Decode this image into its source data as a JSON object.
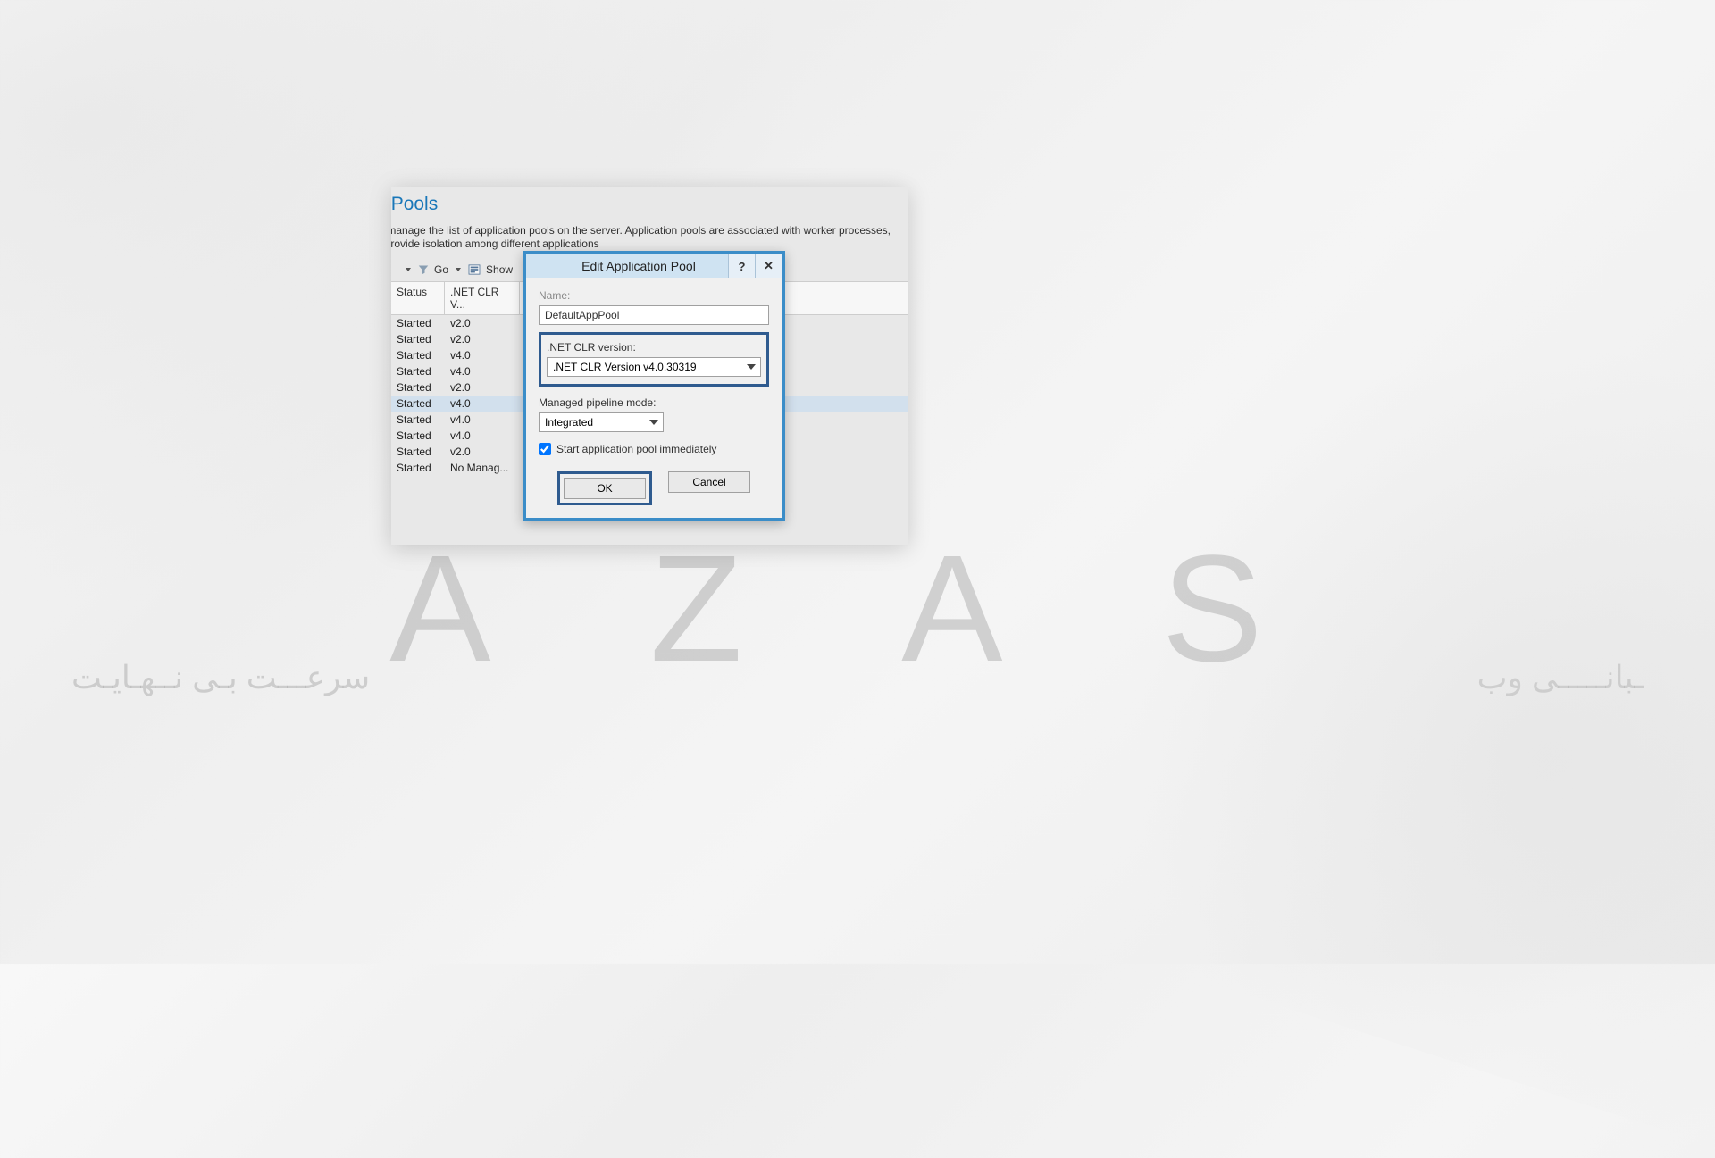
{
  "background": {
    "watermark_letters": "A  Z  A      S",
    "watermark_sub_left": "سرعـــت بـی نــهـایـت",
    "watermark_sub_right": "ـبانـــــی وب"
  },
  "page": {
    "title_truncated": "tion Pools",
    "description_truncated": "w and manage the list of application pools on the server. Application pools are associated with worker processes, con\nd provide isolation among different applications"
  },
  "toolbar": {
    "go_label": "Go",
    "show_label": "Show"
  },
  "columns": {
    "status": "Status",
    "clr": ".NET CLR V..."
  },
  "rows": [
    {
      "status": "Started",
      "clr": "v2.0"
    },
    {
      "status": "Started",
      "clr": "v2.0"
    },
    {
      "status": "Started",
      "clr": "v4.0"
    },
    {
      "status": "Started",
      "clr": "v4.0"
    },
    {
      "status": "Started",
      "clr": "v2.0"
    },
    {
      "status": "Started",
      "clr": "v4.0",
      "highlight": true
    },
    {
      "status": "Started",
      "clr": "v4.0"
    },
    {
      "status": "Started",
      "clr": "v4.0"
    },
    {
      "status": "Started",
      "clr": "v2.0"
    },
    {
      "status": "Started",
      "clr": "No Manag..."
    }
  ],
  "dialog": {
    "title": "Edit Application Pool",
    "help_symbol": "?",
    "close_symbol": "✕",
    "name_label": "Name:",
    "name_value": "DefaultAppPool",
    "clr_label": ".NET CLR version:",
    "clr_value": ".NET CLR Version v4.0.30319",
    "pipeline_label": "Managed pipeline mode:",
    "pipeline_value": "Integrated",
    "start_checkbox_label": "Start application pool immediately",
    "start_checkbox_checked": true,
    "ok_label": "OK",
    "cancel_label": "Cancel"
  }
}
